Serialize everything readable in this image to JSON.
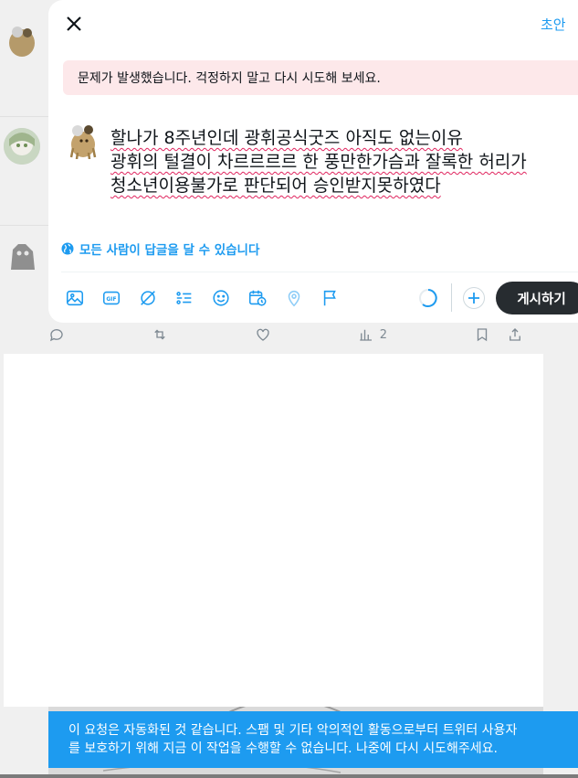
{
  "composer": {
    "close_label": "Close",
    "drafts_label": "초안",
    "error_message": "문제가 발생했습니다. 걱정하지 말고 다시 시도해 보세요.",
    "tweet_lines": [
      "할나가 8주년인데 광휘공식굿즈 아직도 없는이유",
      "광휘의 털결이 차르르르르 한 풍만한가슴과 잘록한 허리가",
      "청소년이용불가로 판단되어 승인받지못하였다"
    ],
    "reply_setting": "모든 사람이 답글을 달 수 있습니다",
    "post_button": "게시하기",
    "toolbar_icons": [
      "image-icon",
      "gif-icon",
      "grok-icon",
      "poll-icon",
      "emoji-icon",
      "schedule-icon",
      "location-icon",
      "flag-icon"
    ]
  },
  "background_post": {
    "views_count": "2"
  },
  "toast": {
    "line1": "이 요청은 자동화된 것 같습니다. 스팸 및 기타 악의적인 활동으로부터 트위터 사용자",
    "line2": "를 보호하기 위해 지금 이 작업을 수행할 수 없습니다. 나중에 다시 시도해주세요."
  },
  "colors": {
    "accent": "#1d9bf0",
    "error_bg": "#fde8ea",
    "post_button_bg": "#272c30",
    "toast_bg": "#1d9bf0"
  }
}
